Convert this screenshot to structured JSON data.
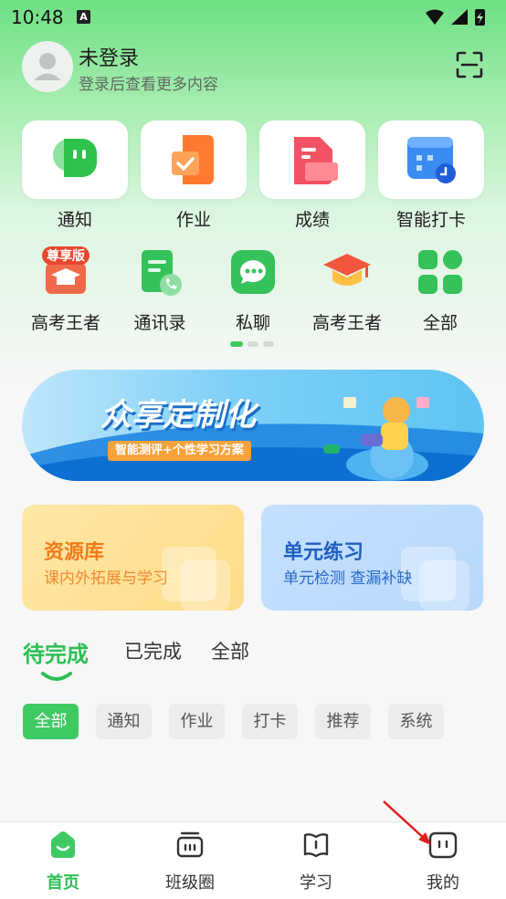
{
  "status_bar": {
    "time": "10:48",
    "badge": "A"
  },
  "user": {
    "name": "未登录",
    "subtitle": "登录后查看更多内容"
  },
  "big_grid": [
    {
      "label": "通知",
      "icon": "chat-bubble-icon"
    },
    {
      "label": "作业",
      "icon": "homework-doc-icon"
    },
    {
      "label": "成绩",
      "icon": "grades-doc-icon"
    },
    {
      "label": "智能打卡",
      "icon": "calendar-clock-icon"
    }
  ],
  "small_grid": [
    {
      "label": "高考王者",
      "icon": "premium-grad-cap-icon",
      "badge": "尊享版"
    },
    {
      "label": "通讯录",
      "icon": "contacts-phone-icon"
    },
    {
      "label": "私聊",
      "icon": "private-chat-icon"
    },
    {
      "label": "高考王者",
      "icon": "grad-cap-icon"
    },
    {
      "label": "全部",
      "icon": "all-apps-icon"
    }
  ],
  "banner": {
    "title": "众享定制化",
    "subtitle": "智能测评+个性学习方案"
  },
  "features": [
    {
      "title": "资源库",
      "subtitle": "课内外拓展与学习"
    },
    {
      "title": "单元练习",
      "subtitle": "单元检测  查漏补缺"
    }
  ],
  "tabs": [
    {
      "label": "待完成",
      "active": true
    },
    {
      "label": "已完成",
      "active": false
    },
    {
      "label": "全部",
      "active": false
    }
  ],
  "chips": [
    {
      "label": "全部",
      "active": true
    },
    {
      "label": "通知",
      "active": false
    },
    {
      "label": "作业",
      "active": false
    },
    {
      "label": "打卡",
      "active": false
    },
    {
      "label": "推荐",
      "active": false
    },
    {
      "label": "系统",
      "active": false
    }
  ],
  "bottom_nav": [
    {
      "label": "首页",
      "active": true
    },
    {
      "label": "班级圈",
      "active": false
    },
    {
      "label": "学习",
      "active": false
    },
    {
      "label": "我的",
      "active": false
    }
  ],
  "colors": {
    "primary": "#2dbf55",
    "chip_active": "#3fc963"
  }
}
